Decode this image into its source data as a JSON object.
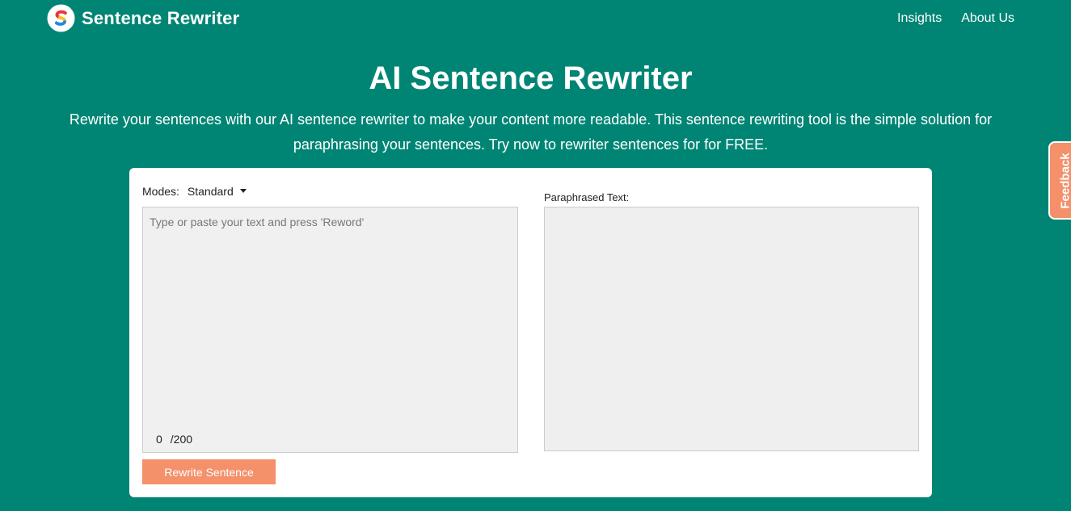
{
  "brand": {
    "name": "Sentence Rewriter",
    "logo_letter": "S",
    "logo_colors": [
      "#e53935",
      "#fbc02d",
      "#1e88e5"
    ]
  },
  "nav": {
    "links": [
      {
        "label": "Insights"
      },
      {
        "label": "About Us"
      }
    ]
  },
  "hero": {
    "title": "AI Sentence Rewriter",
    "description": "Rewrite your sentences with our AI sentence rewriter to make your content more readable. This sentence rewriting tool is the simple solution for paraphrasing your sentences. Try now to rewriter sentences for for FREE."
  },
  "tool": {
    "modes_label": "Modes:",
    "mode_selected": "Standard",
    "input_value": "",
    "input_placeholder": "Type or paste your text and press 'Reword'",
    "char_count": "0",
    "char_limit": "/200",
    "output_label": "Paraphrased Text:",
    "button_label": "Rewrite Sentence"
  },
  "feedback": {
    "label": "Feedback"
  },
  "colors": {
    "background": "#008575",
    "accent": "#f4906a",
    "card": "#ffffff",
    "textarea_bg": "#f0f0f0"
  }
}
